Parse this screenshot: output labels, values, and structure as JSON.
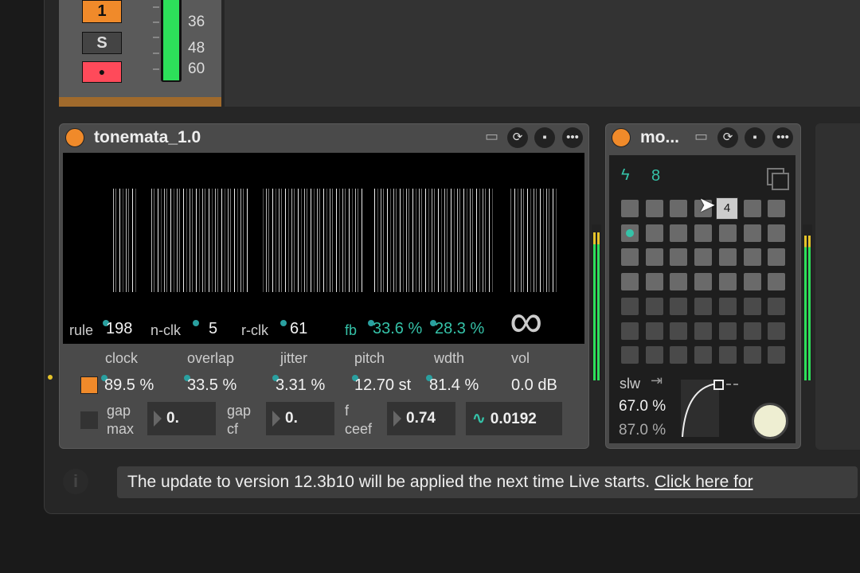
{
  "track": {
    "number_label": "1",
    "solo_label": "S",
    "scale": [
      "36",
      "48",
      "60"
    ]
  },
  "device1": {
    "title": "tonemata_1.0",
    "params_row1": {
      "rule_label": "rule",
      "rule_value": "198",
      "nclk_label": "n-clk",
      "nclk_value": "5",
      "rclk_label": "r-clk",
      "rclk_value": "61",
      "fb_label": "fb",
      "fb_value1": "33.6 %",
      "fb_value2": "28.3 %",
      "loop_symbol": "∞"
    },
    "params_headers": [
      "clock",
      "overlap",
      "jitter",
      "pitch",
      "wdth",
      "vol"
    ],
    "params_values": [
      "89.5 %",
      "33.5 %",
      "3.31 %",
      "12.70 st",
      "81.4 %",
      "0.0 dB"
    ],
    "bottom": {
      "gap_max_label1": "gap",
      "gap_max_label2": "max",
      "gap_max_value": "0.",
      "gap_cf_label1": "gap",
      "gap_cf_label2": "cf",
      "gap_cf_value": "0.",
      "f_ceef_label1": "f",
      "f_ceef_label2": "ceef",
      "f_ceef_value": "0.74",
      "wave_value": "0.0192"
    }
  },
  "device2": {
    "title": "mo...",
    "count": "8",
    "tooltip_value": "4",
    "slw_label": "slw",
    "slw_value1": "67.0 %",
    "slw_value2": "87.0 %"
  },
  "notification": {
    "text": "The update to version 12.3b10 will be applied the next time Live starts. ",
    "link": "Click here for",
    "info_icon": "i"
  },
  "colors": {
    "accent_orange": "#f08a2a",
    "teal": "#35c2a8",
    "meter_green": "#2de05a"
  }
}
